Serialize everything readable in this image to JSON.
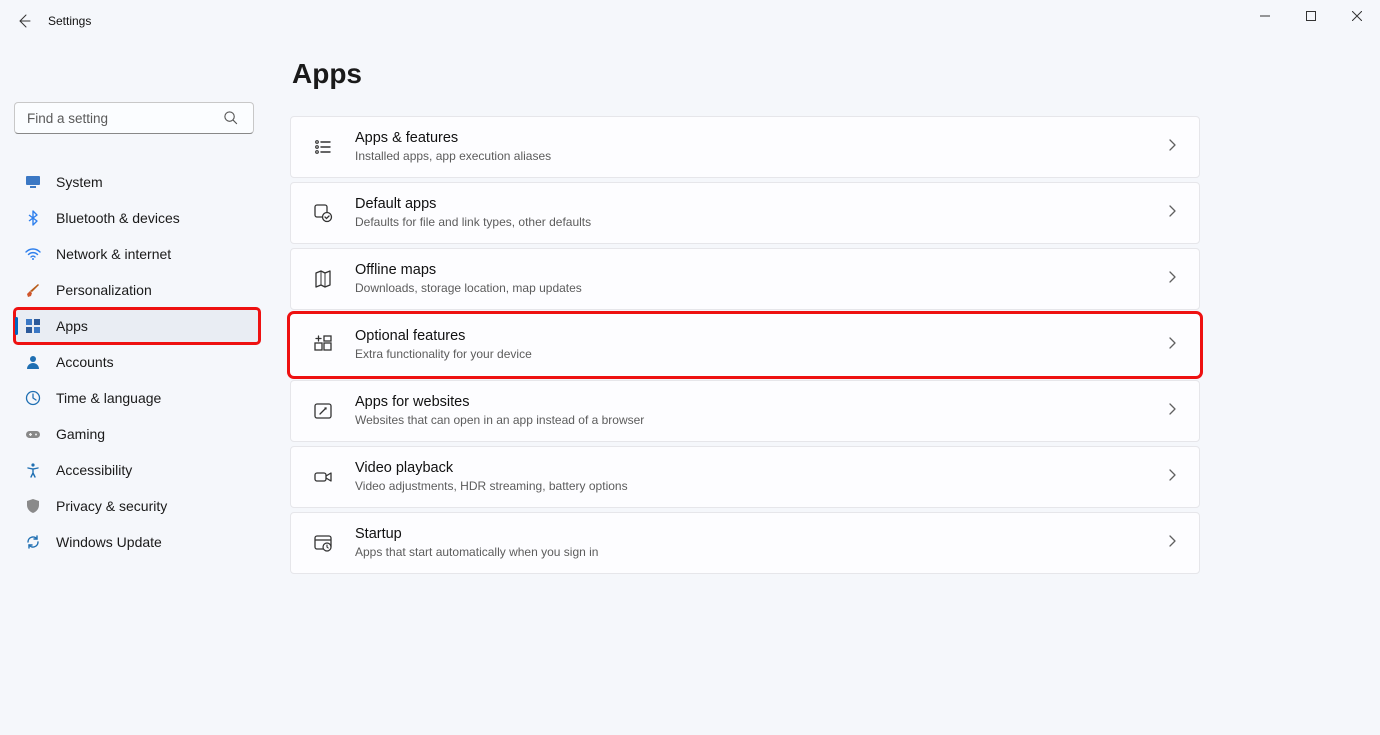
{
  "window": {
    "title": "Settings"
  },
  "search": {
    "placeholder": "Find a setting"
  },
  "sidebar": {
    "items": [
      {
        "label": "System",
        "icon": "display-icon",
        "color": "#3b78c4"
      },
      {
        "label": "Bluetooth & devices",
        "icon": "bluetooth-icon",
        "color": "#2f80ed"
      },
      {
        "label": "Network & internet",
        "icon": "wifi-icon",
        "color": "#2f80ed"
      },
      {
        "label": "Personalization",
        "icon": "paintbrush-icon",
        "color": "#c0392b"
      },
      {
        "label": "Apps",
        "icon": "apps-icon",
        "color": "#3b5ea3",
        "active": true,
        "highlight": true
      },
      {
        "label": "Accounts",
        "icon": "person-icon",
        "color": "#1f6fb2"
      },
      {
        "label": "Time & language",
        "icon": "clock-globe-icon",
        "color": "#1f6fb2"
      },
      {
        "label": "Gaming",
        "icon": "gamepad-icon",
        "color": "#7a7a7a"
      },
      {
        "label": "Accessibility",
        "icon": "accessibility-icon",
        "color": "#1f6fb2"
      },
      {
        "label": "Privacy & security",
        "icon": "shield-icon",
        "color": "#7a7a7a"
      },
      {
        "label": "Windows Update",
        "icon": "update-icon",
        "color": "#1f6fb2"
      }
    ]
  },
  "main": {
    "heading": "Apps",
    "cards": [
      {
        "title": "Apps & features",
        "sub": "Installed apps, app execution aliases",
        "icon": "list-icon"
      },
      {
        "title": "Default apps",
        "sub": "Defaults for file and link types, other defaults",
        "icon": "default-apps-icon"
      },
      {
        "title": "Offline maps",
        "sub": "Downloads, storage location, map updates",
        "icon": "map-icon"
      },
      {
        "title": "Optional features",
        "sub": "Extra functionality for your device",
        "icon": "optional-features-icon",
        "highlight": true
      },
      {
        "title": "Apps for websites",
        "sub": "Websites that can open in an app instead of a browser",
        "icon": "link-app-icon"
      },
      {
        "title": "Video playback",
        "sub": "Video adjustments, HDR streaming, battery options",
        "icon": "video-icon"
      },
      {
        "title": "Startup",
        "sub": "Apps that start automatically when you sign in",
        "icon": "startup-icon"
      }
    ]
  }
}
